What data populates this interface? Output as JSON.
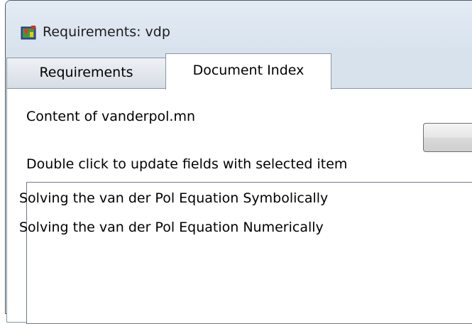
{
  "window": {
    "title": "Requirements: vdp",
    "icon": "simulink-requirements-icon"
  },
  "tabs": [
    {
      "label": "Requirements",
      "active": false
    },
    {
      "label": "Document Index",
      "active": true
    }
  ],
  "document_index": {
    "content_label": "Content of vanderpol.mn",
    "instruction": "Double click to update fields with selected item",
    "items": [
      "Solving the van der Pol Equation Symbolically",
      "Solving the van der Pol Equation Numerically"
    ]
  },
  "colors": {
    "window_frame": "#d9e3ee",
    "panel_background": "#ffffff",
    "border": "#8a96a3"
  }
}
